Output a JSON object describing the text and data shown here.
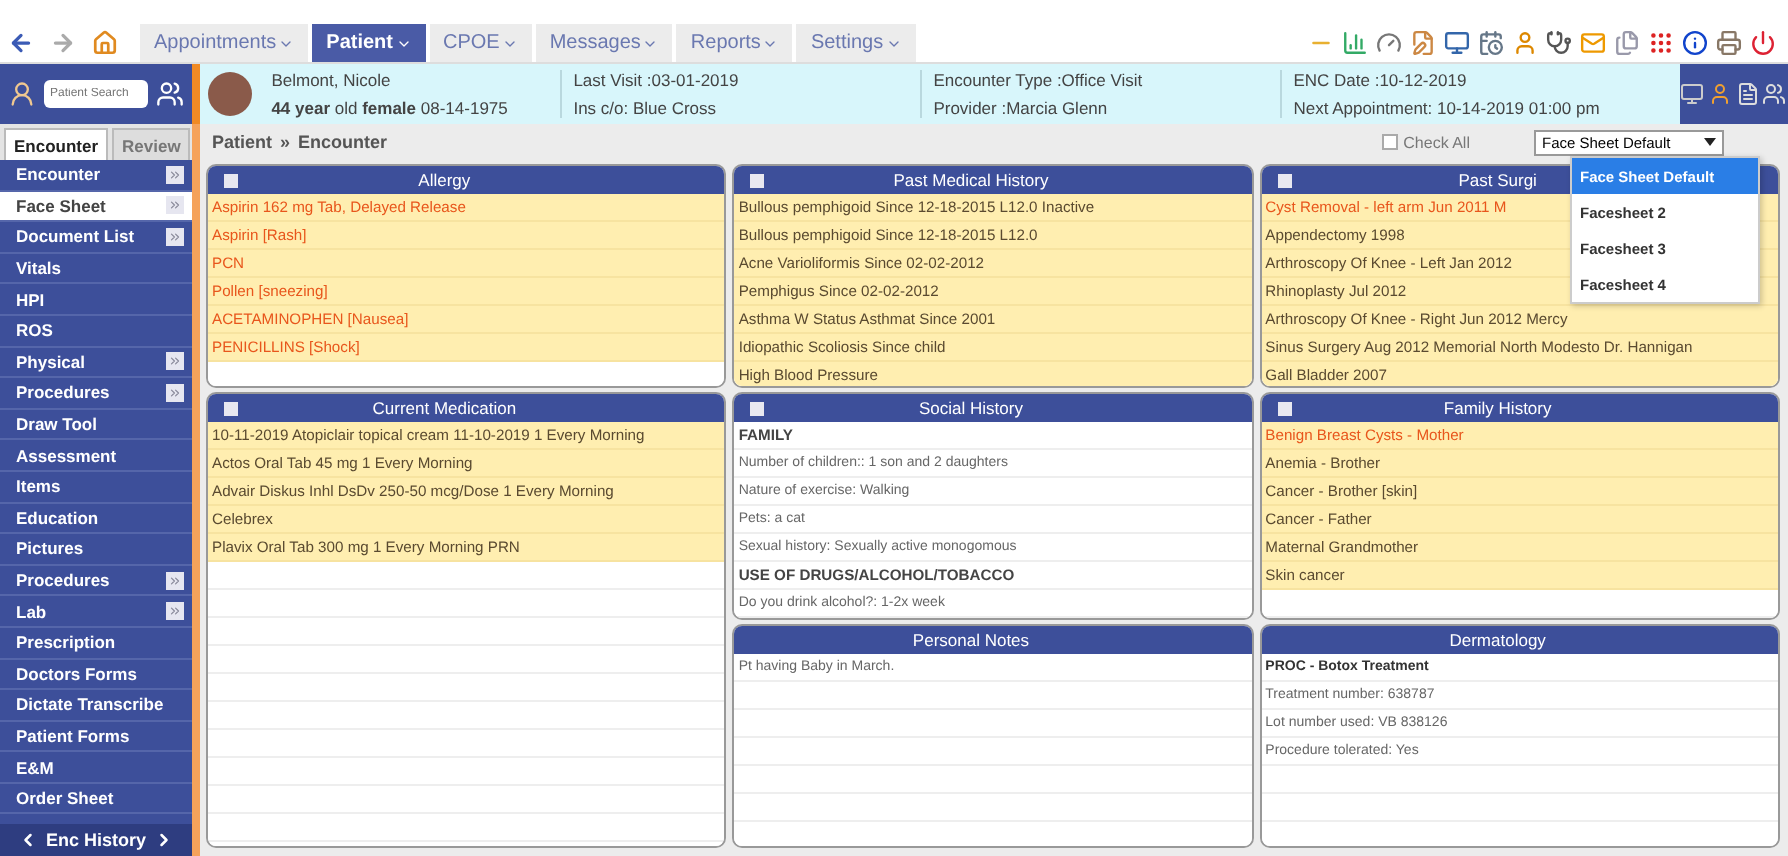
{
  "menu": [
    {
      "label": "Appointments",
      "selected": false
    },
    {
      "label": "Patient",
      "selected": true
    },
    {
      "label": "CPOE",
      "selected": false
    },
    {
      "label": "Messages",
      "selected": false
    },
    {
      "label": "Reports",
      "selected": false
    },
    {
      "label": "Settings",
      "selected": false
    }
  ],
  "patient_search": {
    "placeholder": "Patient Search"
  },
  "patient": {
    "name": "Belmont, Nicole",
    "summary": "**44 year** old **female** 08-14-1975",
    "fields": [
      [
        "Last Visit :03-01-2019",
        "Ins c/o: Blue Cross"
      ],
      [
        "Encounter Type :Office Visit",
        "Provider :Marcia Glenn"
      ],
      [
        "ENC Date :10-12-2019",
        "Next Appointment: 10-14-2019 01:00 pm"
      ]
    ]
  },
  "sidebar": {
    "tabs": [
      {
        "label": "Encounter",
        "selected": true
      },
      {
        "label": "Review",
        "selected": false
      }
    ],
    "items": [
      {
        "label": "Encounter",
        "has_submenu": true,
        "selected": false
      },
      {
        "label": "Face Sheet",
        "has_submenu": true,
        "selected": true
      },
      {
        "label": "Document List",
        "has_submenu": true,
        "selected": false
      },
      {
        "label": "Vitals",
        "has_submenu": false,
        "selected": false
      },
      {
        "label": "HPI",
        "has_submenu": false,
        "selected": false
      },
      {
        "label": "ROS",
        "has_submenu": false,
        "selected": false
      },
      {
        "label": "Physical",
        "has_submenu": true,
        "selected": false
      },
      {
        "label": "Procedures",
        "has_submenu": true,
        "selected": false
      },
      {
        "label": "Draw Tool",
        "has_submenu": false,
        "selected": false
      },
      {
        "label": "Assessment",
        "has_submenu": false,
        "selected": false
      },
      {
        "label": "Items",
        "has_submenu": false,
        "selected": false
      },
      {
        "label": "Education",
        "has_submenu": false,
        "selected": false
      },
      {
        "label": "Pictures",
        "has_submenu": false,
        "selected": false
      },
      {
        "label": "Procedures",
        "has_submenu": true,
        "selected": false
      },
      {
        "label": "Lab",
        "has_submenu": true,
        "selected": false
      },
      {
        "label": "Prescription",
        "has_submenu": false,
        "selected": false
      },
      {
        "label": "Doctors Forms",
        "has_submenu": false,
        "selected": false
      },
      {
        "label": "Dictate Transcribe",
        "has_submenu": false,
        "selected": false
      },
      {
        "label": "Patient Forms",
        "has_submenu": false,
        "selected": false
      },
      {
        "label": "E&M",
        "has_submenu": false,
        "selected": false
      },
      {
        "label": "Order Sheet",
        "has_submenu": false,
        "selected": false
      }
    ],
    "footer": "Enc History"
  },
  "breadcrumb": {
    "first": "Patient",
    "separator": "»",
    "current": "Encounter"
  },
  "check_all": {
    "label": "Check All",
    "checked": false
  },
  "facesheet_select": {
    "value": "Face Sheet Default",
    "options": [
      {
        "label": "Face Sheet Default",
        "selected": true
      },
      {
        "label": "Facesheet 2",
        "selected": false
      },
      {
        "label": "Facesheet 3",
        "selected": false
      },
      {
        "label": "Facesheet 4",
        "selected": false
      }
    ]
  },
  "panels": [
    {
      "title": "Allergy",
      "checkbox": true,
      "checked": false,
      "highlighted": true,
      "items": [
        {
          "text": "Aspirin 162 mg Tab, Delayed Release",
          "kind": "alert"
        },
        {
          "text": "Aspirin [Rash]",
          "kind": "alert"
        },
        {
          "text": "PCN",
          "kind": "alert"
        },
        {
          "text": "Pollen [sneezing]",
          "kind": "alert"
        },
        {
          "text": "ACETAMINOPHEN [Nausea]",
          "kind": "alert"
        },
        {
          "text": "PENICILLINS [Shock]",
          "kind": "alert"
        }
      ]
    },
    {
      "title": "Past Medical History",
      "checkbox": true,
      "checked": false,
      "highlighted": true,
      "items": [
        {
          "text": "Bullous pemphigoid Since 12-18-2015 L12.0 Inactive",
          "kind": "normal"
        },
        {
          "text": "Bullous pemphigoid Since 12-18-2015 L12.0",
          "kind": "normal"
        },
        {
          "text": "Acne Varioliformis Since 02-02-2012",
          "kind": "normal"
        },
        {
          "text": "Pemphigus Since 02-02-2012",
          "kind": "normal"
        },
        {
          "text": "Asthma W Status Asthmat Since 2001",
          "kind": "normal"
        },
        {
          "text": "Idiopathic Scoliosis Since child",
          "kind": "normal"
        },
        {
          "text": "High Blood Pressure",
          "kind": "normal"
        }
      ]
    },
    {
      "title": "Past Surgi",
      "checkbox": true,
      "checked": false,
      "highlighted": true,
      "items": [
        {
          "text": "Cyst Removal - left arm Jun 2011 M",
          "kind": "alert"
        },
        {
          "text": "Appendectomy 1998",
          "kind": "normal"
        },
        {
          "text": "Arthroscopy Of Knee - Left Jan 2012",
          "kind": "normal"
        },
        {
          "text": "Rhinoplasty Jul 2012",
          "kind": "normal"
        },
        {
          "text": "Arthroscopy Of Knee - Right Jun 2012 Mercy",
          "kind": "normal"
        },
        {
          "text": "Sinus Surgery Aug 2012 Memorial North Modesto Dr. Hannigan",
          "kind": "normal"
        },
        {
          "text": "Gall Bladder 2007",
          "kind": "normal"
        }
      ]
    },
    {
      "title": "Current Medication",
      "checkbox": true,
      "checked": false,
      "highlighted": true,
      "items": [
        {
          "text": "10-11-2019 Atopiclair topical cream 11-10-2019 1 Every Morning",
          "kind": "normal"
        },
        {
          "text": "Actos Oral Tab 45 mg 1 Every Morning",
          "kind": "normal"
        },
        {
          "text": "Advair Diskus Inhl DsDv 250-50 mcg/Dose 1 Every Morning",
          "kind": "normal"
        },
        {
          "text": "Celebrex",
          "kind": "normal"
        },
        {
          "text": "Plavix Oral Tab 300 mg 1 Every Morning PRN",
          "kind": "normal"
        }
      ]
    },
    {
      "title": "Social History",
      "checkbox": true,
      "checked": false,
      "highlighted": false,
      "items": [
        {
          "text": "FAMILY",
          "kind": "heading"
        },
        {
          "text": "Number of children:: 1 son and 2 daughters",
          "kind": "note"
        },
        {
          "text": "Nature of exercise: Walking",
          "kind": "note"
        },
        {
          "text": "Pets: a cat",
          "kind": "note"
        },
        {
          "text": "Sexual history: Sexually active monogomous",
          "kind": "note"
        },
        {
          "text": "USE OF DRUGS/ALCOHOL/TOBACCO",
          "kind": "heading"
        },
        {
          "text": "Do you drink alcohol?: 1-2x week",
          "kind": "note"
        }
      ]
    },
    {
      "title": "Family History",
      "checkbox": true,
      "checked": false,
      "highlighted": true,
      "items": [
        {
          "text": "Benign Breast Cysts - Mother",
          "kind": "alert"
        },
        {
          "text": "Anemia - Brother",
          "kind": "normal"
        },
        {
          "text": "Cancer - Brother [skin]",
          "kind": "normal"
        },
        {
          "text": "Cancer - Father",
          "kind": "normal"
        },
        {
          "text": "Maternal Grandmother",
          "kind": "normal"
        },
        {
          "text": "Skin cancer",
          "kind": "normal"
        }
      ]
    },
    {
      "title": "Personal Notes",
      "checkbox": false,
      "highlighted": false,
      "items": [
        {
          "text": "Pt having Baby in March.",
          "kind": "note"
        }
      ]
    },
    {
      "title": "Dermatology",
      "checkbox": false,
      "highlighted": false,
      "items": [
        {
          "text": "PROC - Botox Treatment",
          "kind": "subheading"
        },
        {
          "text": "Treatment number: 638787",
          "kind": "note"
        },
        {
          "text": "Lot number used: VB 838126",
          "kind": "note"
        },
        {
          "text": "Procedure tolerated: Yes",
          "kind": "note"
        }
      ]
    }
  ]
}
